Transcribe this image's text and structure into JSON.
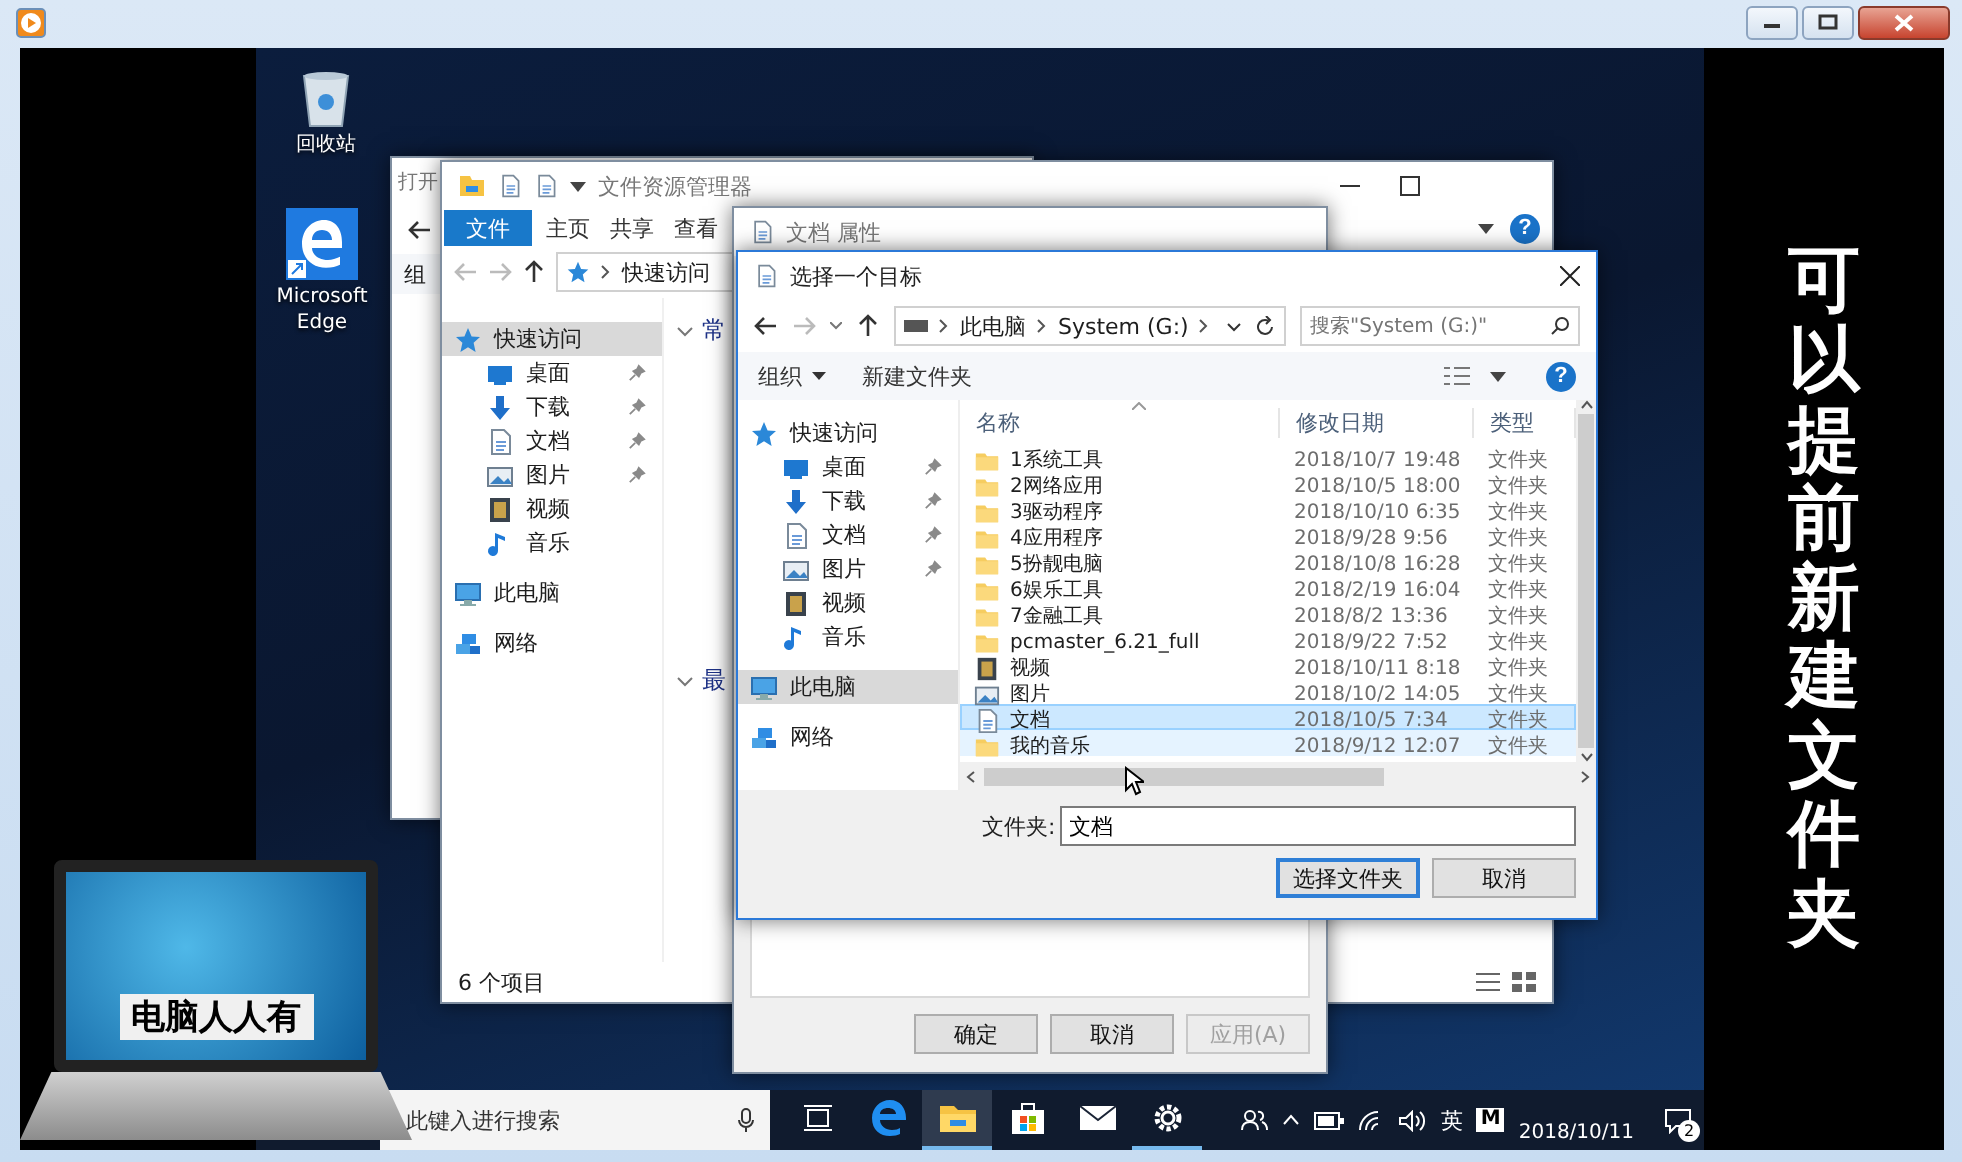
{
  "desktop_icons": [
    {
      "kind": "recycle",
      "label": "回收站"
    },
    {
      "kind": "edge",
      "label": "Microsoft Edge"
    }
  ],
  "open_window": {
    "title": "打开",
    "toolbar_text": "组"
  },
  "explorer": {
    "title": "文件资源管理器",
    "help": "?",
    "address": "快速访问",
    "status": "6 个项目",
    "sections": [
      "常",
      "最"
    ],
    "tabs": [
      {
        "label": "文件",
        "selected": true
      },
      {
        "label": "主页",
        "selected": false
      },
      {
        "label": "共享",
        "selected": false
      },
      {
        "label": "查看",
        "selected": false
      }
    ],
    "nav": [
      {
        "label": "快速访问",
        "kind": "star",
        "selected": true,
        "children": [
          {
            "label": "桌面",
            "kind": "desktop",
            "selected": false,
            "pinned": true
          },
          {
            "label": "下载",
            "kind": "download",
            "selected": false,
            "pinned": true
          },
          {
            "label": "文档",
            "kind": "document",
            "selected": false,
            "pinned": true
          },
          {
            "label": "图片",
            "kind": "picture",
            "selected": false,
            "pinned": true
          },
          {
            "label": "视频",
            "kind": "video",
            "selected": false,
            "pinned": false
          },
          {
            "label": "音乐",
            "kind": "music",
            "selected": false,
            "pinned": false
          }
        ]
      },
      {
        "label": "此电脑",
        "kind": "pc",
        "selected": false
      },
      {
        "label": "网络",
        "kind": "network",
        "selected": false
      }
    ]
  },
  "properties": {
    "title": "文档 属性",
    "buttons": [
      {
        "label": "确定",
        "disabled": false
      },
      {
        "label": "取消",
        "disabled": false
      },
      {
        "label": "应用(A)",
        "disabled": true
      }
    ]
  },
  "dialog": {
    "title": "选择一个目标",
    "path": [
      "此电脑",
      "System (G:)"
    ],
    "search": {
      "placeholder": "搜索\"System (G:)\""
    },
    "toolbar": {
      "organize": "组织",
      "new_folder": "新建文件夹",
      "help": "?"
    },
    "nav": [
      {
        "label": "快速访问",
        "kind": "star",
        "selected": false,
        "children": [
          {
            "label": "桌面",
            "kind": "desktop",
            "selected": false,
            "pinned": true
          },
          {
            "label": "下载",
            "kind": "download",
            "selected": false,
            "pinned": true
          },
          {
            "label": "文档",
            "kind": "document",
            "selected": false,
            "pinned": true
          },
          {
            "label": "图片",
            "kind": "picture",
            "selected": false,
            "pinned": true
          },
          {
            "label": "视频",
            "kind": "video",
            "selected": false,
            "pinned": false
          },
          {
            "label": "音乐",
            "kind": "music",
            "selected": false,
            "pinned": false
          }
        ]
      },
      {
        "label": "此电脑",
        "kind": "pc",
        "selected": true
      },
      {
        "label": "网络",
        "kind": "network",
        "selected": false
      }
    ],
    "columns": [
      "名称",
      "修改日期",
      "类型"
    ],
    "rows": [
      {
        "name": "1系统工具",
        "date": "2018/10/7 19:48",
        "type": "文件夹",
        "kind": "folder",
        "selected": false,
        "hovered": false
      },
      {
        "name": "2网络应用",
        "date": "2018/10/5 18:00",
        "type": "文件夹",
        "kind": "folder",
        "selected": false,
        "hovered": false
      },
      {
        "name": "3驱动程序",
        "date": "2018/10/10 6:35",
        "type": "文件夹",
        "kind": "folder",
        "selected": false,
        "hovered": false
      },
      {
        "name": "4应用程序",
        "date": "2018/9/28 9:56",
        "type": "文件夹",
        "kind": "folder",
        "selected": false,
        "hovered": false
      },
      {
        "name": "5扮靓电脑",
        "date": "2018/10/8 16:28",
        "type": "文件夹",
        "kind": "folder",
        "selected": false,
        "hovered": false
      },
      {
        "name": "6娱乐工具",
        "date": "2018/2/19 16:04",
        "type": "文件夹",
        "kind": "folder",
        "selected": false,
        "hovered": false
      },
      {
        "name": "7金融工具",
        "date": "2018/8/2 13:36",
        "type": "文件夹",
        "kind": "folder",
        "selected": false,
        "hovered": false
      },
      {
        "name": "pcmaster_6.21_full",
        "date": "2018/9/22 7:52",
        "type": "文件夹",
        "kind": "folder",
        "selected": false,
        "hovered": false
      },
      {
        "name": "视频",
        "date": "2018/10/11 8:18",
        "type": "文件夹",
        "kind": "video",
        "selected": false,
        "hovered": false
      },
      {
        "name": "图片",
        "date": "2018/10/2 14:05",
        "type": "文件夹",
        "kind": "picture",
        "selected": false,
        "hovered": false
      },
      {
        "name": "文档",
        "date": "2018/10/5 7:34",
        "type": "文件夹",
        "kind": "document",
        "selected": true,
        "hovered": false
      },
      {
        "name": "我的音乐",
        "date": "2018/9/12 12:07",
        "type": "文件夹",
        "kind": "folder",
        "selected": false,
        "hovered": true
      }
    ],
    "folder_label": "文件夹:",
    "folder_value": "文档",
    "buttons": [
      {
        "label": "选择文件夹",
        "default": true
      },
      {
        "label": "取消",
        "default": false
      }
    ]
  },
  "taskbar": {
    "search": {
      "placeholder": "此键入进行搜索"
    },
    "apps": [
      {
        "kind": "taskview",
        "active": false,
        "running": false
      },
      {
        "kind": "edge",
        "active": false,
        "running": false
      },
      {
        "kind": "explorer",
        "active": true,
        "running": true
      },
      {
        "kind": "store",
        "active": false,
        "running": false
      },
      {
        "kind": "mail",
        "active": false,
        "running": false
      },
      {
        "kind": "settings",
        "active": false,
        "running": true
      }
    ],
    "ime": "英",
    "badge": "M",
    "date": "2018/10/11",
    "notifications": "2"
  },
  "caption": "可以提前新建文件夹",
  "logo": {
    "text": "电脑人人有"
  }
}
